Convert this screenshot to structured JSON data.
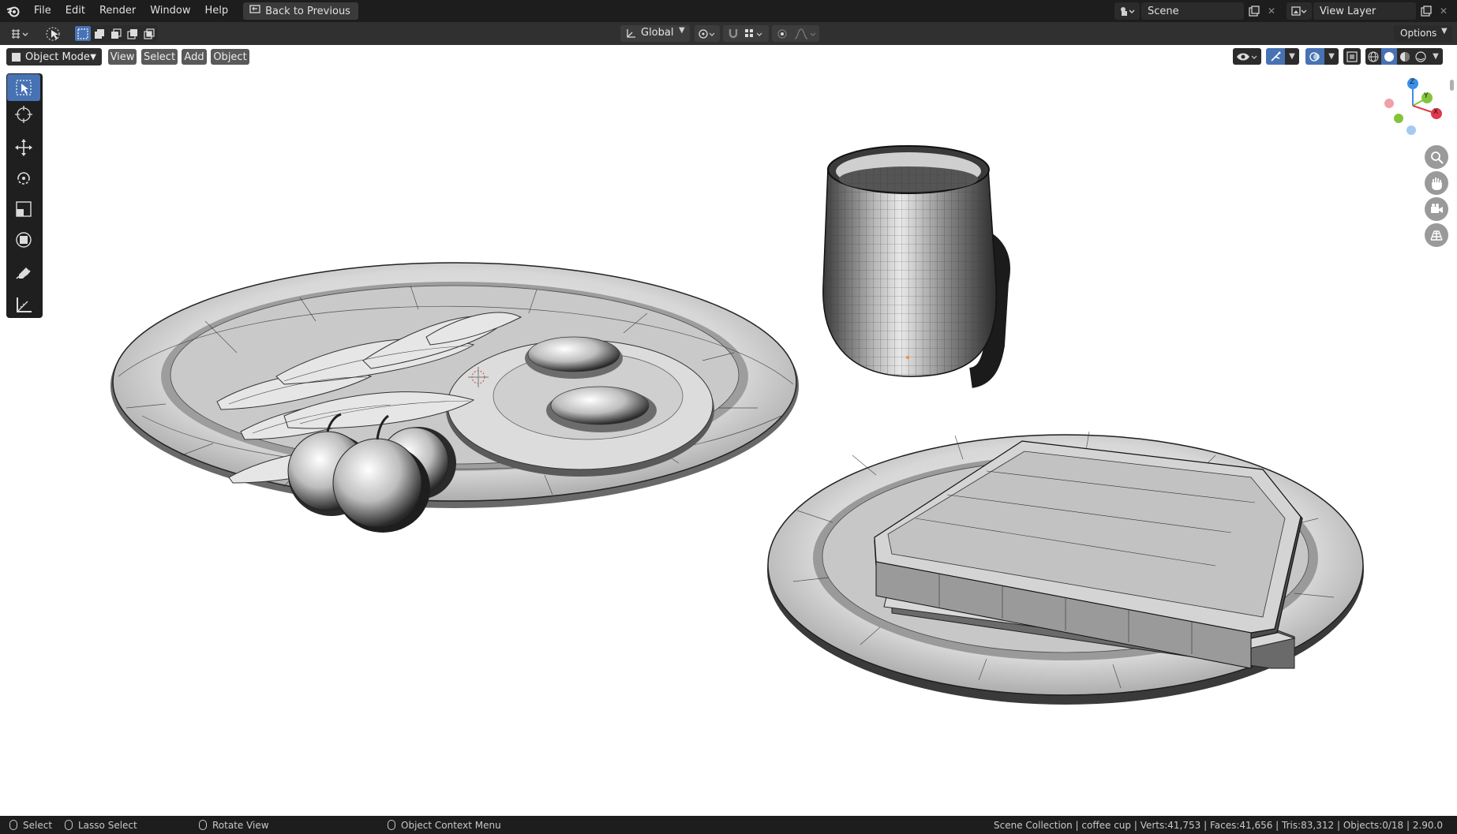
{
  "menu": {
    "items": [
      "File",
      "Edit",
      "Render",
      "Window",
      "Help"
    ],
    "back_button": "Back to Previous"
  },
  "scene": {
    "label": "Scene",
    "view_layer": "View Layer"
  },
  "header": {
    "orientation": "Global",
    "options": "Options"
  },
  "viewport_header": {
    "mode": "Object Mode",
    "view": "View",
    "select": "Select",
    "add": "Add",
    "object": "Object"
  },
  "tools": [
    "select-box",
    "cursor",
    "move",
    "rotate",
    "scale",
    "transform",
    "annotate",
    "measure"
  ],
  "gizmo": {
    "z": "Z",
    "y": "Y",
    "x": "X"
  },
  "status": {
    "select": "Select",
    "lasso": "Lasso Select",
    "rotate": "Rotate View",
    "context": "Object Context Menu",
    "info": "Scene Collection | coffee cup | Verts:41,753 | Faces:41,656 | Tris:83,312 | Objects:0/18 | 2.90.0"
  },
  "colors": {
    "accent": "#4772b3",
    "axis_x": "#e0394b",
    "axis_y": "#83c53a",
    "axis_z": "#3b8de8"
  }
}
